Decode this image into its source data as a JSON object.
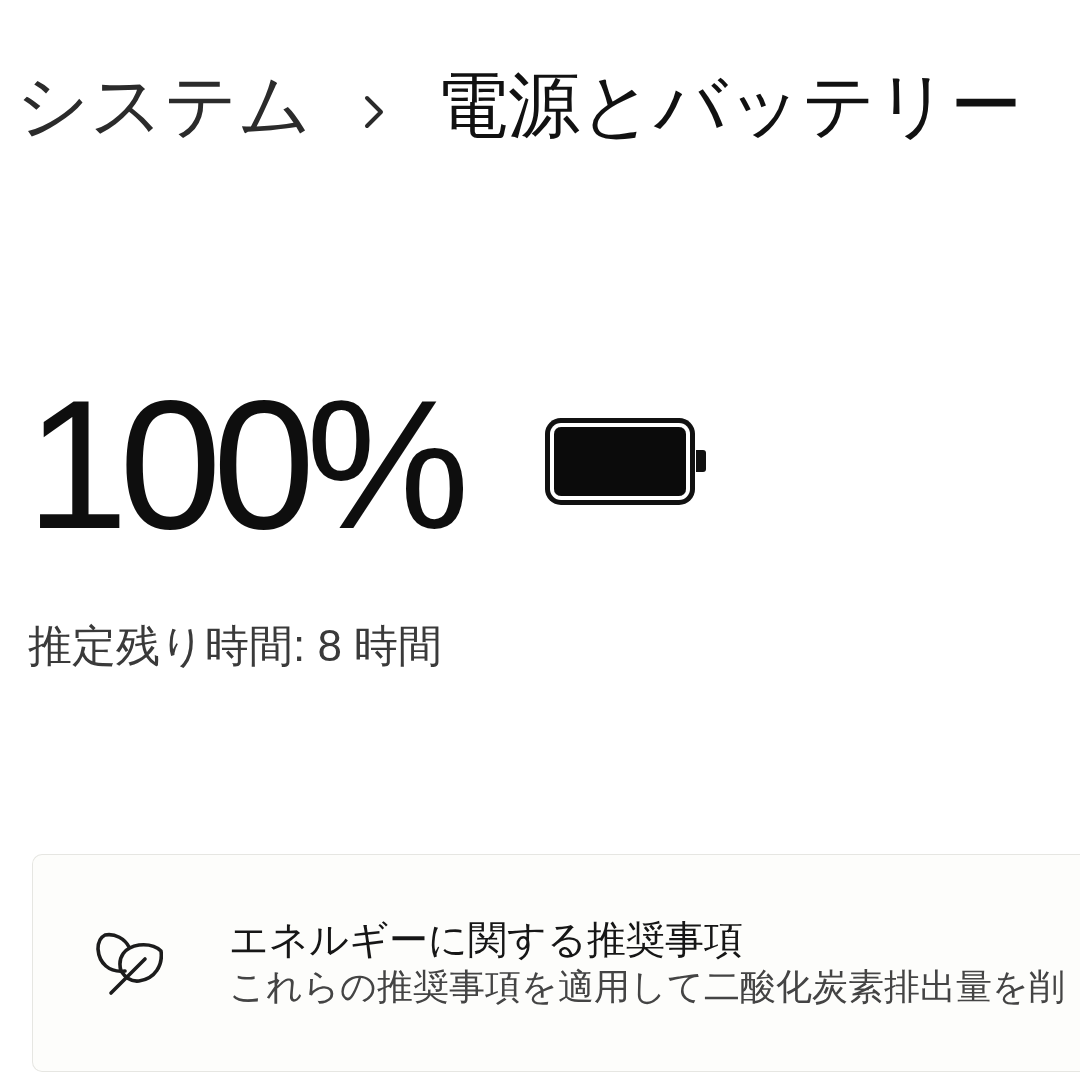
{
  "breadcrumb": {
    "parent": "システム",
    "current": "電源とバッテリー"
  },
  "battery": {
    "percent": "100%",
    "level": 1,
    "estimate": "推定残り時間: 8 時間"
  },
  "recommendation_card": {
    "title": "エネルギーに関する推奨事項",
    "description": "これらの推奨事項を適用して二酸化炭素排出量を削"
  }
}
